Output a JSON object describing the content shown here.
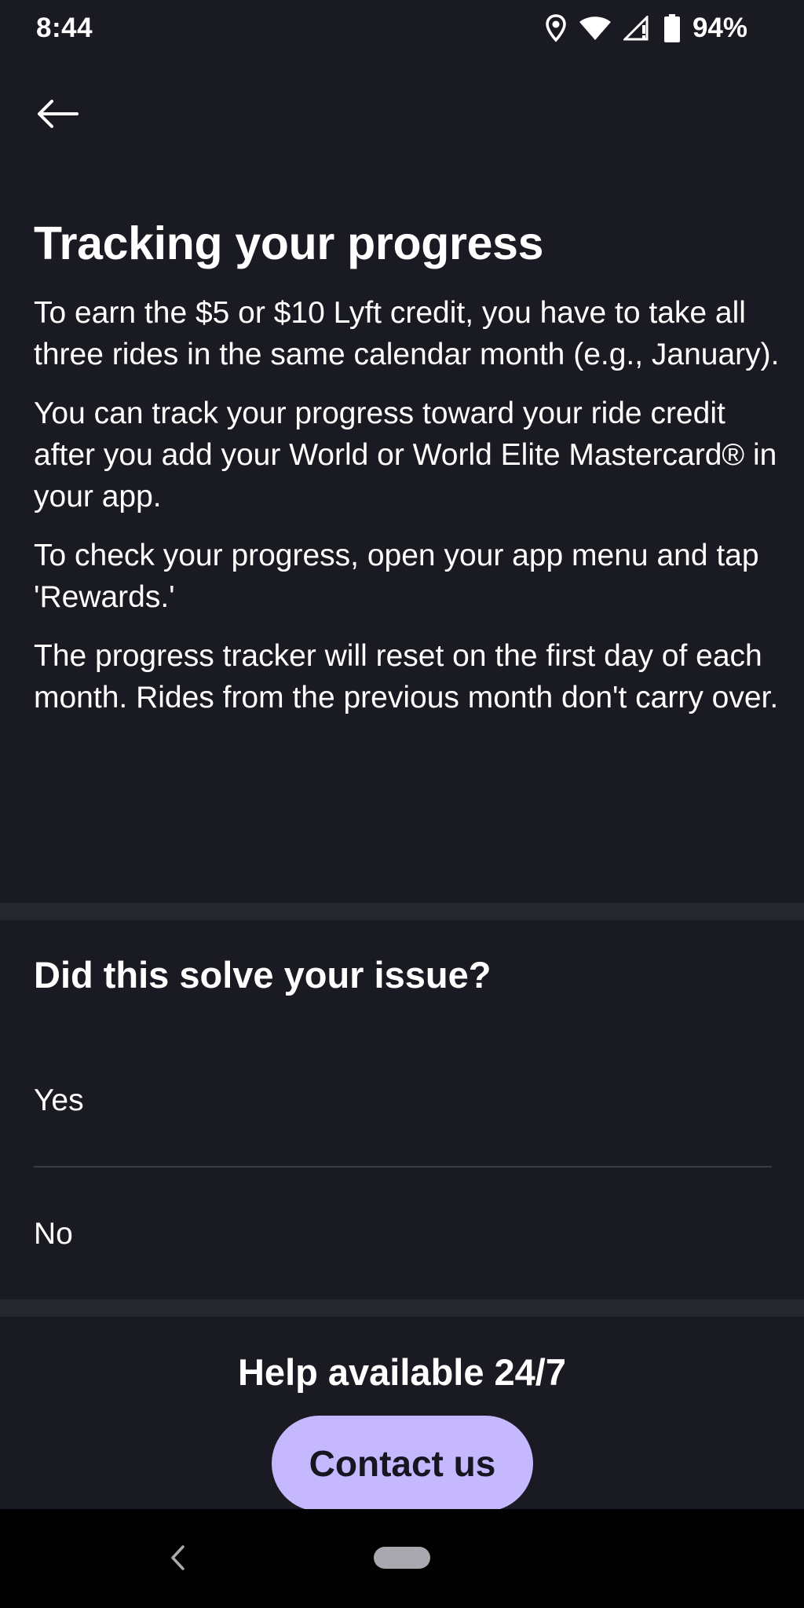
{
  "status_bar": {
    "time": "8:44",
    "battery": "94%",
    "icons": [
      "location-icon",
      "wifi-icon",
      "signal-icon",
      "battery-icon"
    ]
  },
  "header": {
    "back_icon": "arrow-left-icon"
  },
  "article": {
    "title": "Tracking your progress",
    "paragraphs": [
      "To earn the $5 or $10 Lyft credit, you have to take all three rides in the same calendar month (e.g., January).",
      "You can track your progress toward your ride credit after you add your World or World Elite Mastercard® in your app.",
      "To check your progress, open your app menu and tap 'Rewards.'",
      "The progress tracker will reset on the first day of each month. Rides from the previous month don't carry over."
    ]
  },
  "feedback": {
    "question": "Did this solve your issue?",
    "options": [
      "Yes",
      "No"
    ]
  },
  "help": {
    "title": "Help available 24/7",
    "contact_label": "Contact us"
  },
  "nav_bar": {
    "back_icon": "nav-back-icon",
    "home_icon": "home-pill-icon"
  },
  "colors": {
    "background": "#1a1a22",
    "divider": "#26262e",
    "accent": "#c5b8ff",
    "nav_bar": "#000000"
  }
}
